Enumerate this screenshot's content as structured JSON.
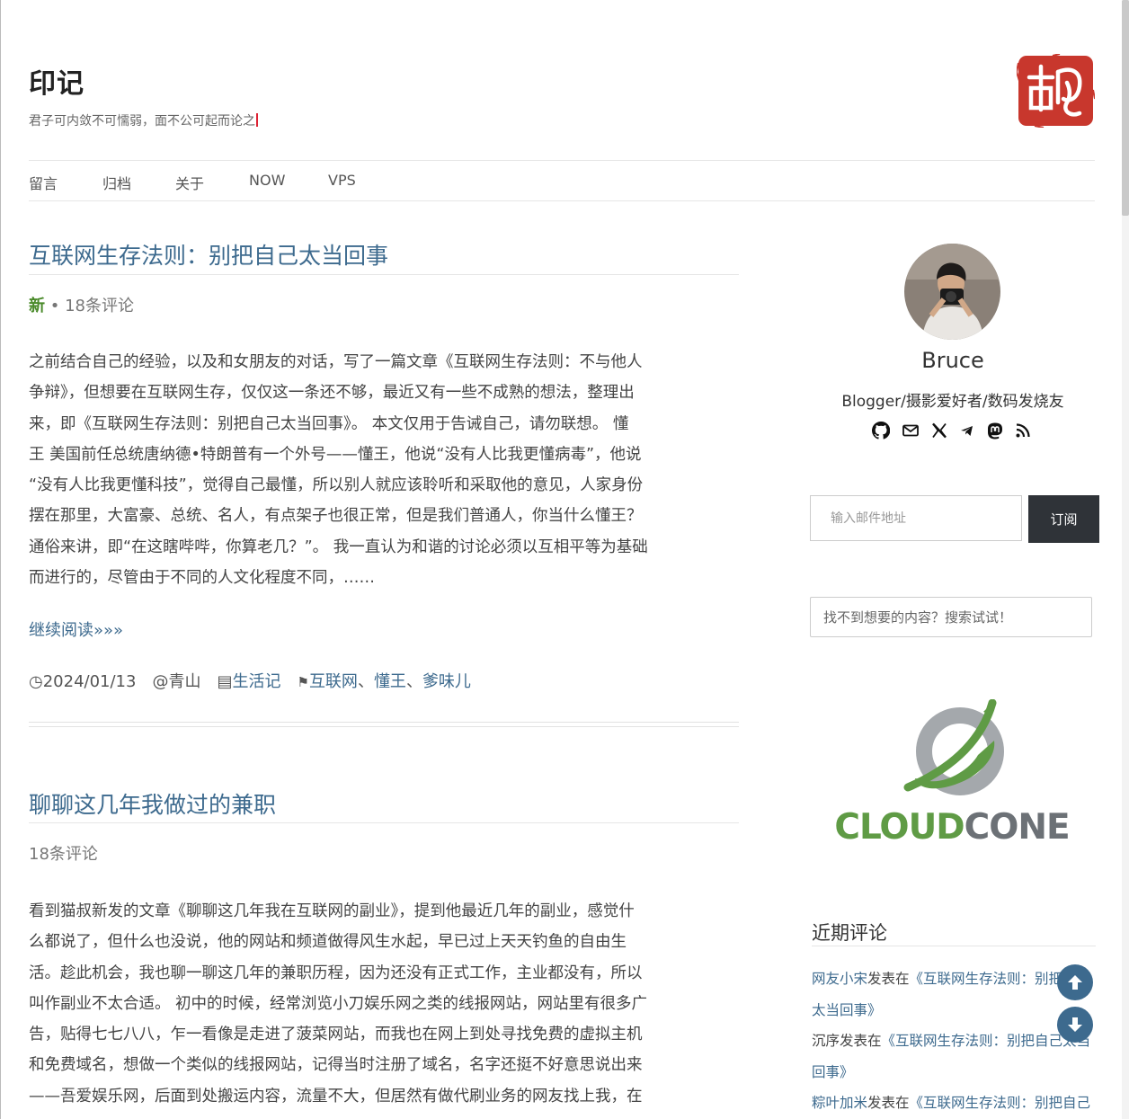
{
  "site": {
    "title": "印记",
    "tagline": "君子可内敛不可懦弱，面不公可起而论之"
  },
  "nav": [
    "留言",
    "归档",
    "关于",
    "NOW",
    "VPS"
  ],
  "posts": [
    {
      "title": "互联网生存法则：别把自己太当回事",
      "badge": "新",
      "separator": " • ",
      "comments": "18条评论",
      "excerpt": "之前结合自己的经验，以及和女朋友的对话，写了一篇文章《互联网生存法则：不与他人\n争辩》，但想要在互联网生存，仅仅这一条还不够，最近又有一些不成熟的想法，整理出\n来，即《互联网生存法则：别把自己太当回事》。 本文仅用于告诫自己，请勿联想。 懂\n王 美国前任总统唐纳德•特朗普有一个外号——懂王，他说“没有人比我更懂病毒”，他说\n“没有人比我更懂科技”，觉得自己最懂，所以别人就应该聆听和采取他的意见，人家身份\n摆在那里，大富豪、总统、名人，有点架子也很正常，但是我们普通人，你当什么懂王？\n通俗来讲，即“在这瞎哔哔，你算老几？”。 我一直认为和谐的讨论必须以互相平等为基础\n而进行的，尽管由于不同的人文化程度不同，……",
      "read_more": "继续阅读»»»",
      "date": "2024/01/13",
      "author": "@青山",
      "category": "生活记",
      "tags": [
        "互联网",
        "懂王",
        "爹味儿"
      ],
      "tag_sep": "、"
    },
    {
      "title": "聊聊这几年我做过的兼职",
      "comments": "18条评论",
      "excerpt": "看到猫叔新发的文章《聊聊这几年我在互联网的副业》，提到他最近几年的副业，感觉什\n么都说了，但什么也没说，他的网站和频道做得风生水起，早已过上天天钓鱼的自由生\n活。趁此机会，我也聊一聊这几年的兼职历程，因为还没有正式工作，主业都没有，所以\n叫作副业不太合适。 初中的时候，经常浏览小刀娱乐网之类的线报网站，网站里有很多广\n告，贴得七七八八，乍一看像是走进了菠菜网站，而我也在网上到处寻找免费的虚拟主机\n和免费域名，想做一个类似的线报网站，记得当时注册了域名，名字还挺不好意思说出来\n——吾爱娱乐网，后面到处搬运内容，流量不大，但居然有做代刷业务的网友找上我，在"
    }
  ],
  "profile": {
    "name": "Bruce",
    "bio": "Blogger/摄影爱好者/数码发烧友",
    "social_icons": [
      "github-icon",
      "email-icon",
      "x-icon",
      "telegram-icon",
      "mastodon-icon",
      "rss-icon"
    ]
  },
  "subscribe": {
    "placeholder": "输入邮件地址",
    "button": "订阅"
  },
  "search": {
    "placeholder": "找不到想要的内容？搜索试试！"
  },
  "ad": {
    "brand_part1": "CLOUD",
    "brand_part2": "CONE"
  },
  "recent_comments": {
    "title": "近期评论",
    "items": [
      {
        "author": "网友小宋",
        "verb": "发表在",
        "post": "《互联网生存法则：别把自己太当回事》"
      },
      {
        "author": "沉序",
        "verb": "发表在",
        "post": "《互联网生存法则：别把自己太当回事》"
      },
      {
        "author": "粽叶加米",
        "verb": "发表在",
        "post": "《互联网生存法则：别把自己太当回事》"
      }
    ]
  },
  "colors": {
    "link": "#3d6a8e",
    "badge": "#4a8a2a",
    "seal": "#c8372d",
    "button_dark": "#2f3338"
  }
}
